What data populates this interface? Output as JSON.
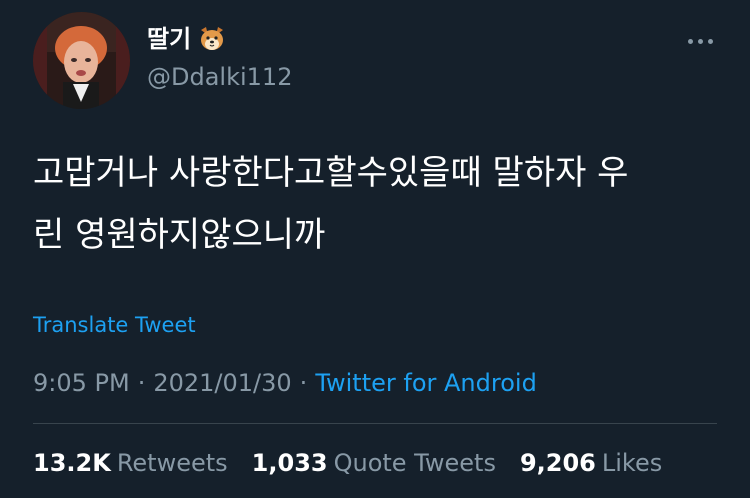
{
  "colors": {
    "background": "#15202b",
    "primary_text": "#ffffff",
    "secondary_text": "#8899a6",
    "accent": "#1da1f2",
    "divider": "#38444d"
  },
  "author": {
    "display_name": "딸기",
    "handle": "@Ddalki112",
    "name_emoji": "dog-face-emoji",
    "avatar": "profile-avatar"
  },
  "more_icon": "more-horizontal-icon",
  "tweet": {
    "text": "고맙거나 사랑한다고할수있을때 말하자 우\n린 영원하지않으니까",
    "translate_label": "Translate Tweet",
    "time": "9:05 PM",
    "separator": "·",
    "date": "2021/01/30",
    "source": "Twitter for Android"
  },
  "stats": {
    "retweets_count": "13.2K",
    "retweets_label": "Retweets",
    "quote_count": "1,033",
    "quote_label": "Quote Tweets",
    "likes_count": "9,206",
    "likes_label": "Likes"
  }
}
